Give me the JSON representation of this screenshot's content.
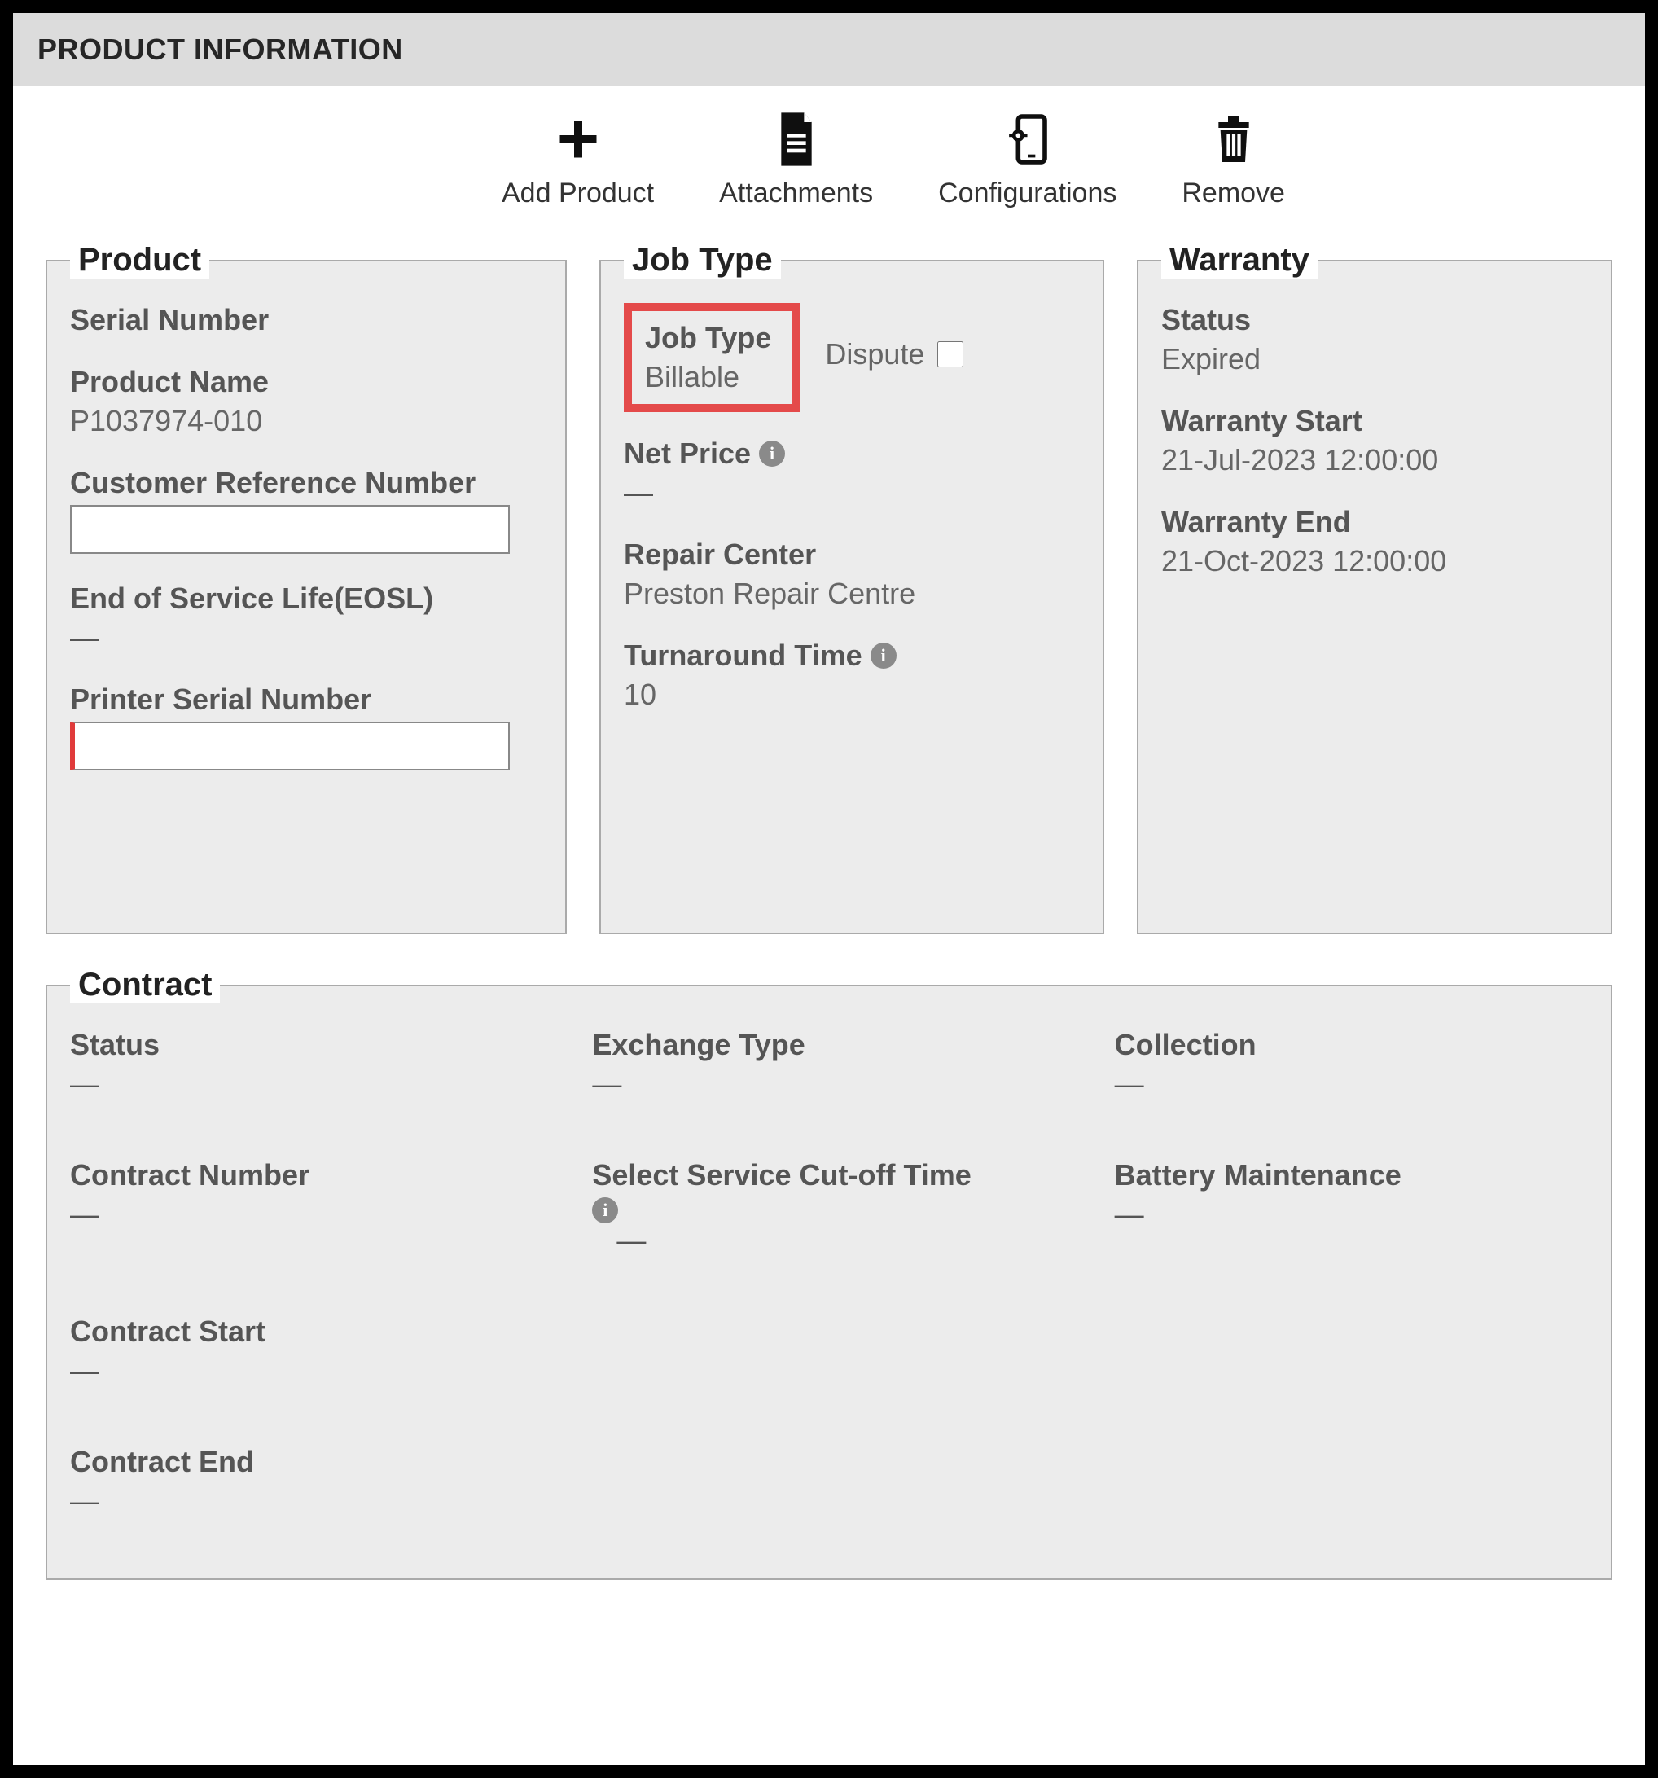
{
  "header": {
    "title": "PRODUCT INFORMATION"
  },
  "toolbar": {
    "add_product": "Add Product",
    "attachments": "Attachments",
    "configurations": "Configurations",
    "remove": "Remove"
  },
  "product": {
    "legend": "Product",
    "serial_number_label": "Serial Number",
    "serial_number_value": "",
    "product_name_label": "Product Name",
    "product_name_value": "P1037974-010",
    "customer_ref_label": "Customer Reference Number",
    "customer_ref_value": "",
    "eosl_label": "End of Service Life(EOSL)",
    "eosl_value": "—",
    "printer_serial_label": "Printer Serial Number",
    "printer_serial_value": ""
  },
  "jobtype": {
    "legend": "Job Type",
    "job_type_label": "Job Type",
    "job_type_value": "Billable",
    "dispute_label": "Dispute",
    "net_price_label": "Net Price",
    "net_price_value": "—",
    "repair_center_label": "Repair Center",
    "repair_center_value": "Preston Repair Centre",
    "turnaround_label": "Turnaround Time",
    "turnaround_value": "10"
  },
  "warranty": {
    "legend": "Warranty",
    "status_label": "Status",
    "status_value": "Expired",
    "start_label": "Warranty Start",
    "start_value": "21-Jul-2023 12:00:00",
    "end_label": "Warranty End",
    "end_value": "21-Oct-2023 12:00:00"
  },
  "contract": {
    "legend": "Contract",
    "status_label": "Status",
    "status_value": "—",
    "contract_number_label": "Contract Number",
    "contract_number_value": "—",
    "contract_start_label": "Contract Start",
    "contract_start_value": "—",
    "contract_end_label": "Contract End",
    "contract_end_value": "—",
    "exchange_type_label": "Exchange Type",
    "exchange_type_value": "—",
    "cutoff_label": "Select Service Cut-off Time",
    "cutoff_value": "—",
    "collection_label": "Collection",
    "collection_value": "—",
    "battery_label": "Battery Maintenance",
    "battery_value": "—"
  },
  "icons": {
    "info_glyph": "i"
  }
}
